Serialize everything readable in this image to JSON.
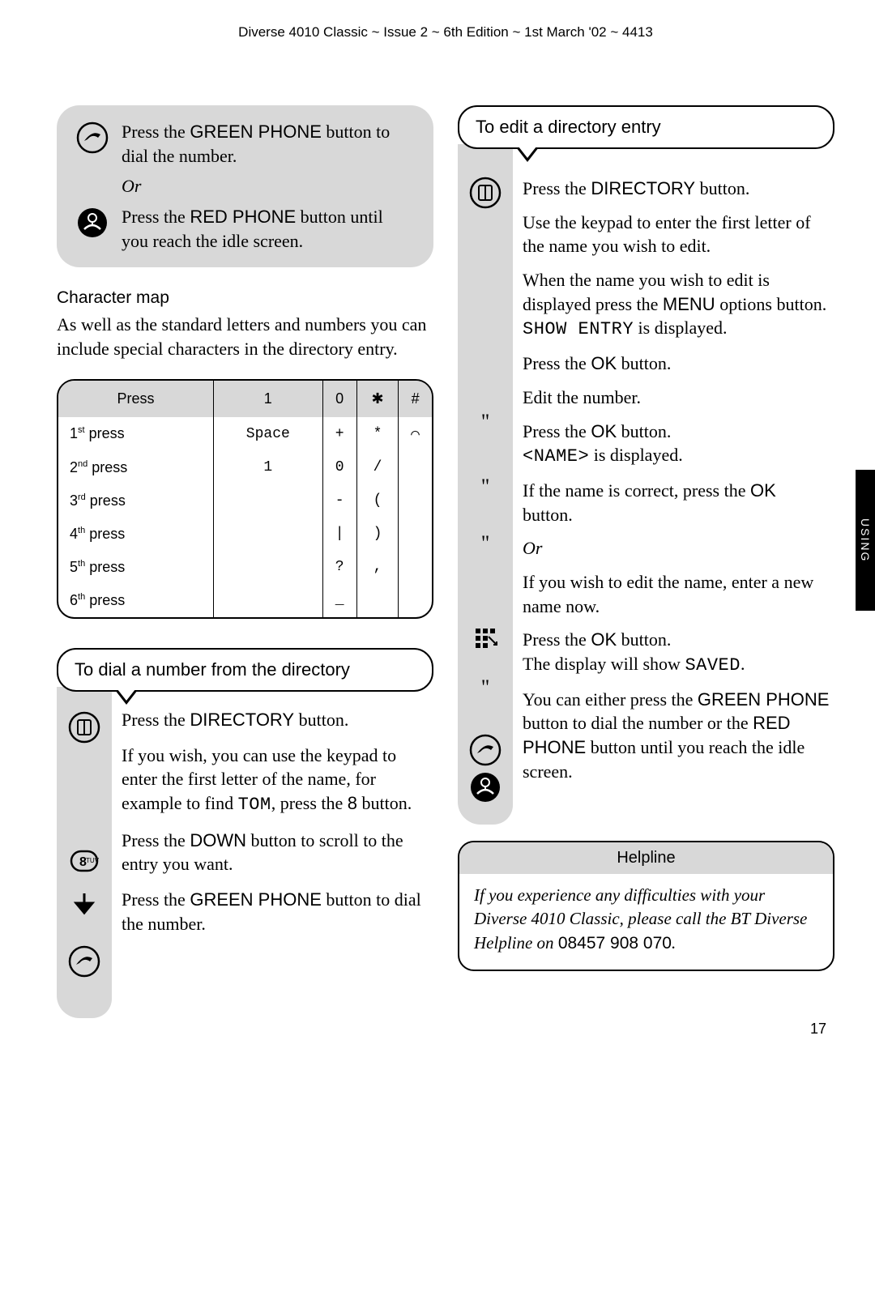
{
  "header": "Diverse 4010 Classic ~ Issue 2 ~ 6th Edition ~ 1st March '02 ~ 4413",
  "side_tab": "USING",
  "page_number": "17",
  "left": {
    "top_block": {
      "green": {
        "pre": "Press the ",
        "bold": "GREEN PHONE",
        "post": " button to dial the number."
      },
      "or": "Or",
      "red": {
        "pre": "Press the ",
        "bold": "RED PHONE",
        "post": " button until you reach the idle screen."
      }
    },
    "char_map": {
      "title": "Character map",
      "intro": "As well as the standard letters and numbers you can include special characters in the directory entry.",
      "headers": [
        "Press",
        "1",
        "0",
        "✱",
        "#"
      ],
      "rows": [
        {
          "label_pre": "1",
          "label_sup": "st",
          "label_post": " press",
          "c1": "Space",
          "c2": "+",
          "c3": "*",
          "c4": "⌒"
        },
        {
          "label_pre": "2",
          "label_sup": "nd",
          "label_post": " press",
          "c1": "1",
          "c2": "0",
          "c3": "/",
          "c4": ""
        },
        {
          "label_pre": "3",
          "label_sup": "rd",
          "label_post": " press",
          "c1": "",
          "c2": "-",
          "c3": "(",
          "c4": ""
        },
        {
          "label_pre": "4",
          "label_sup": "th",
          "label_post": " press",
          "c1": "",
          "c2": "|",
          "c3": ")",
          "c4": ""
        },
        {
          "label_pre": "5",
          "label_sup": "th",
          "label_post": " press",
          "c1": "",
          "c2": "?",
          "c3": ",",
          "c4": ""
        },
        {
          "label_pre": "6",
          "label_sup": "th",
          "label_post": " press",
          "c1": "",
          "c2": "_",
          "c3": "",
          "c4": ""
        }
      ]
    },
    "dial_heading": "To dial a number from the directory",
    "dial_steps": {
      "s1": {
        "pre": "Press the ",
        "bold": "DIRECTORY",
        "post": " button."
      },
      "s2": {
        "pre": "If you wish, you can use the keypad to enter the first letter of the name, for example to find ",
        "mono": "TOM",
        "post": ", press the ",
        "bold": "8",
        "post2": " button."
      },
      "s3": {
        "pre": "Press the ",
        "bold": "DOWN",
        "post": " button to scroll to the entry you want."
      },
      "s4": {
        "pre": "Press the ",
        "bold": "GREEN PHONE",
        "post": " button to dial the number."
      }
    }
  },
  "right": {
    "edit_heading": "To edit a directory entry",
    "steps": {
      "s1": {
        "pre": "Press the ",
        "bold": "DIRECTORY",
        "post": " button."
      },
      "s2": "Use the keypad to enter the first letter of the name you wish to edit.",
      "s3": {
        "pre": "When the name you wish to edit is displayed press the ",
        "bold": "MENU",
        "post": " options button. ",
        "mono": "SHOW ENTRY",
        "post2": " is displayed."
      },
      "s4": {
        "pre": "Press the ",
        "bold": "OK",
        "post": " button."
      },
      "s5": "Edit the number.",
      "s6a": {
        "pre": "Press the ",
        "bold": "OK",
        "post": " button."
      },
      "s6b": {
        "mono": "<NAME>",
        "post": " is displayed."
      },
      "s7": {
        "pre": "If the name is correct, press the ",
        "bold": "OK",
        "post": " button."
      },
      "or": "Or",
      "s8": "If you wish to edit the name, enter a new name now.",
      "s9a": {
        "pre": "Press the ",
        "bold": "OK",
        "post": " button."
      },
      "s9b": {
        "pre": "The display will show ",
        "mono": "SAVED",
        "post": "."
      },
      "s10": {
        "pre": "You can either press the ",
        "bold1": "GREEN PHONE",
        "mid": " button to dial the number or the ",
        "bold2": "RED PHONE",
        "post": " button until you reach the idle screen."
      }
    },
    "helpline": {
      "title": "Helpline",
      "body_pre": "If you experience any difficulties with your Diverse 4010 Classic, please call the BT Diverse Helpline on ",
      "number": "08457 908 070",
      "body_post": "."
    }
  }
}
